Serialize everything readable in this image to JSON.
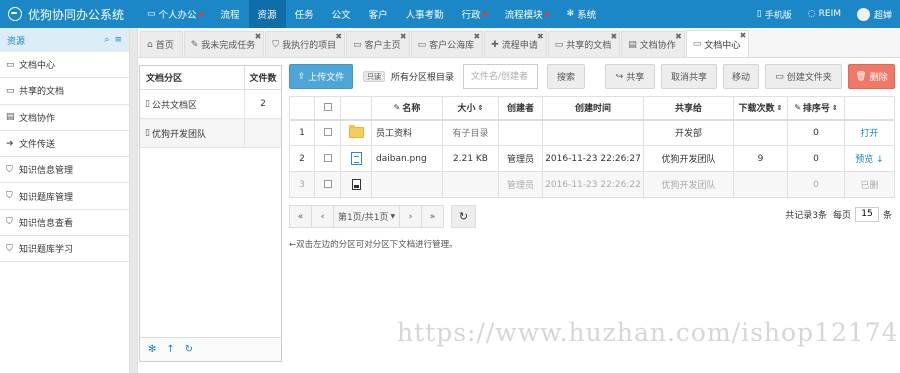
{
  "app": {
    "title": "优狗协同办公系统"
  },
  "nav": [
    {
      "label": "个人办公",
      "icon": "desktop-icon",
      "dot": true,
      "active": false
    },
    {
      "label": "流程",
      "active": false
    },
    {
      "label": "资源",
      "active": true
    },
    {
      "label": "任务",
      "active": false
    },
    {
      "label": "公文",
      "active": false
    },
    {
      "label": "客户",
      "active": false
    },
    {
      "label": "人事考勤",
      "active": false
    },
    {
      "label": "行政",
      "dot": true,
      "active": false
    },
    {
      "label": "流程模块",
      "dot": true,
      "active": false
    },
    {
      "label": "系统",
      "icon": "gear-icon",
      "active": false
    }
  ],
  "topright": {
    "mobile": "手机版",
    "reim": "REIM",
    "user": "超婵"
  },
  "sidebar": {
    "header": "资源",
    "items": [
      {
        "label": "文档中心",
        "icon": "folder-open-icon"
      },
      {
        "label": "共享的文档",
        "icon": "folder-icon"
      },
      {
        "label": "文档协作",
        "icon": "document-icon"
      },
      {
        "label": "文件传送",
        "icon": "send-icon"
      },
      {
        "label": "知识信息管理",
        "icon": "bookmark-icon"
      },
      {
        "label": "知识题库管理",
        "icon": "bookmark-icon"
      },
      {
        "label": "知识信息查看",
        "icon": "bookmark-icon"
      },
      {
        "label": "知识题库学习",
        "icon": "bookmark-icon"
      }
    ]
  },
  "tabs": [
    {
      "label": "首页",
      "icon": "home-icon",
      "closable": false
    },
    {
      "label": "我未完成任务",
      "icon": "pencil-icon",
      "closable": true
    },
    {
      "label": "我执行的项目",
      "icon": "bookmark-icon",
      "closable": true
    },
    {
      "label": "客户主页",
      "icon": "folder-icon",
      "closable": true
    },
    {
      "label": "客户公海库",
      "icon": "folder-icon",
      "closable": true
    },
    {
      "label": "流程申请",
      "icon": "plus-icon",
      "closable": true
    },
    {
      "label": "共享的文档",
      "icon": "folder-icon",
      "closable": true
    },
    {
      "label": "文档协作",
      "icon": "document-icon",
      "closable": true
    },
    {
      "label": "文档中心",
      "icon": "folder-open-icon",
      "closable": true,
      "active": true
    }
  ],
  "categories": {
    "header_name": "文档分区",
    "header_count": "文件数",
    "rows": [
      {
        "name": "公共文档区",
        "count": "2",
        "selected": false
      },
      {
        "name": "优狗开发团队",
        "count": "",
        "selected": true
      }
    ]
  },
  "toolbar": {
    "upload": "上传文件",
    "readonly_badge": "只读",
    "location": "所有分区根目录",
    "search_placeholder": "文件名/创建者",
    "search": "搜索",
    "share": "共享",
    "unshare": "取消共享",
    "move": "移动",
    "new_folder": "创建文件夹",
    "delete": "删除"
  },
  "table": {
    "headers": {
      "name": "名称",
      "size": "大小",
      "creator": "创建者",
      "created": "创建时间",
      "shared_to": "共享给",
      "downloads": "下载次数",
      "sort_no": "排序号"
    },
    "rows": [
      {
        "no": "1",
        "type": "folder",
        "name": "员工资料",
        "size": "有子目录",
        "creator": "",
        "created": "",
        "shared_to": "开发部",
        "downloads": "",
        "sort_no": "0",
        "action": "打开",
        "deleted": false
      },
      {
        "no": "2",
        "type": "image-file",
        "name": "daiban.png",
        "size": "2.21 KB",
        "creator": "管理员",
        "created": "2016-11-23 22:26:27",
        "shared_to": "优狗开发团队",
        "downloads": "9",
        "sort_no": "0",
        "action": "预览",
        "deleted": false
      },
      {
        "no": "3",
        "type": "file",
        "name": "",
        "size": "",
        "creator": "管理员",
        "created": "2016-11-23 22:26:22",
        "shared_to": "优狗开发团队",
        "downloads": "",
        "sort_no": "0",
        "action": "已删",
        "deleted": true
      }
    ]
  },
  "pager": {
    "first": "«",
    "prev": "‹",
    "page_info": "第1页/共1页",
    "next": "›",
    "last": "»",
    "total": "共记录3条",
    "per_page_label": "每页",
    "per_page": "15",
    "per_page_unit": "条"
  },
  "hint": "←双击左边的分区可对分区下文档进行管理。",
  "watermark": "https://www.huzhan.com/ishop12174",
  "colors": {
    "topbar": "#1b87c7",
    "primary": "#4ea6d8",
    "danger": "#ef7866",
    "link": "#1b87c7"
  }
}
